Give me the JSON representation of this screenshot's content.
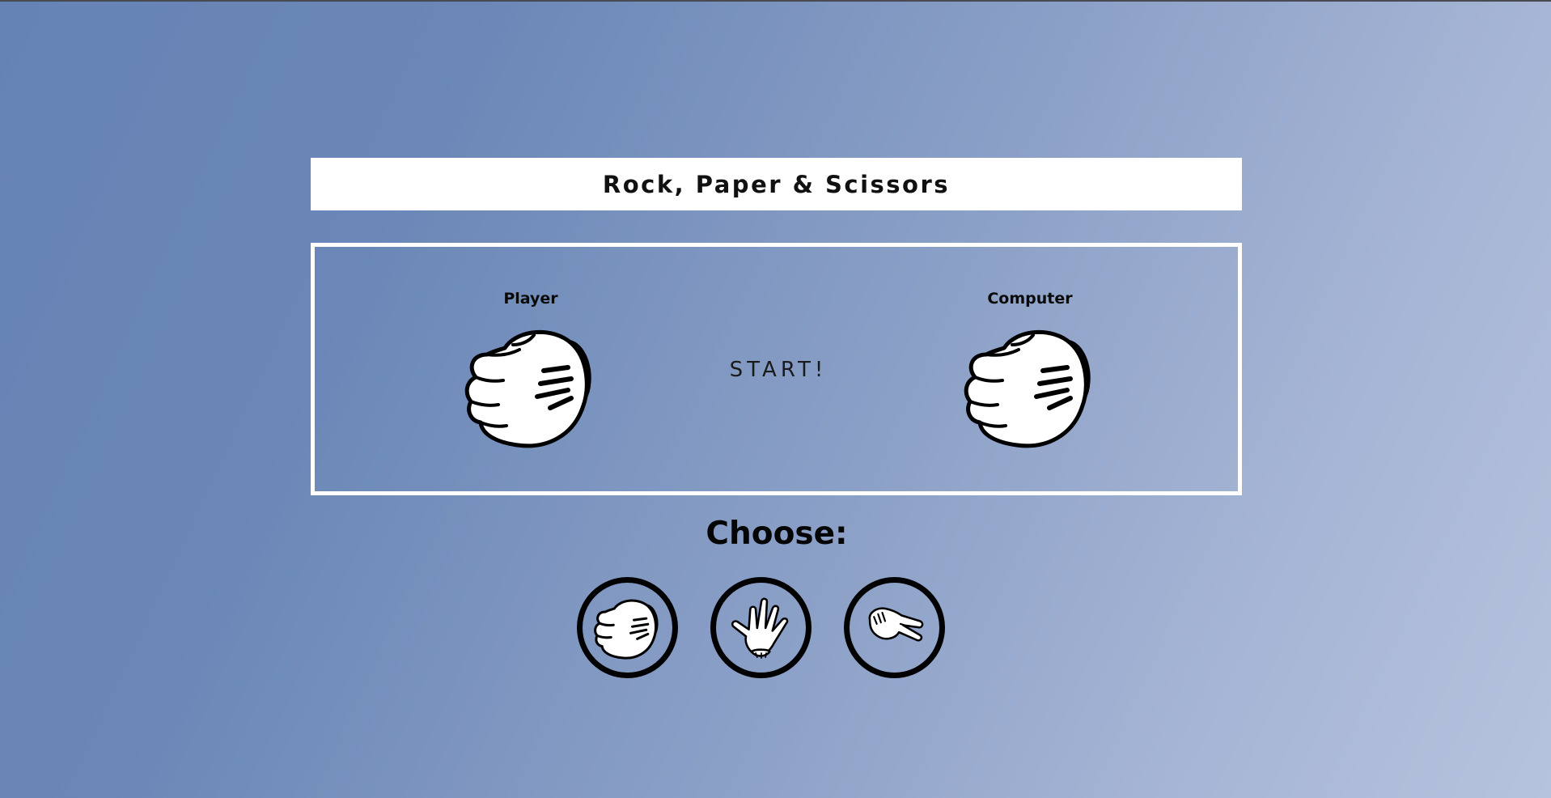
{
  "header": {
    "title": "Rock, Paper & Scissors"
  },
  "arena": {
    "player_label": "Player",
    "computer_label": "Computer",
    "status": "START!",
    "player_hand_icon": "rock-hand-icon",
    "computer_hand_icon": "rock-hand-icon"
  },
  "controls": {
    "heading": "Choose:",
    "options": [
      {
        "icon": "rock-hand-icon"
      },
      {
        "icon": "paper-hand-icon"
      },
      {
        "icon": "scissors-hand-icon"
      }
    ]
  },
  "colors": {
    "background_start": "#6683b5",
    "background_end": "#b6c3de",
    "panel": "#ffffff",
    "ink": "#000000"
  }
}
